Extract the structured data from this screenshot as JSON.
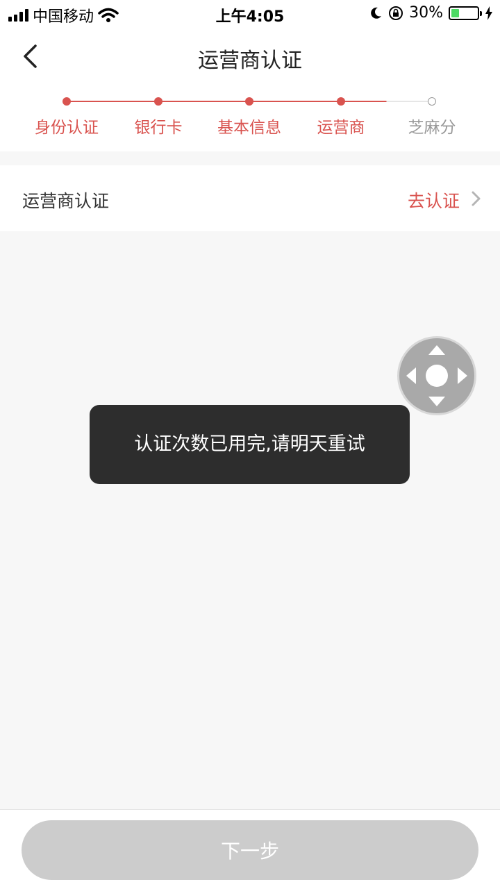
{
  "status_bar": {
    "carrier": "中国移动",
    "time": "上午4:05",
    "battery_percent": "30%",
    "battery_level": 0.3
  },
  "nav": {
    "title": "运营商认证",
    "back_icon": "chevron-left-icon"
  },
  "steps": {
    "items": [
      {
        "label": "身份认证",
        "state": "done"
      },
      {
        "label": "银行卡",
        "state": "done"
      },
      {
        "label": "基本信息",
        "state": "done"
      },
      {
        "label": "运营商",
        "state": "current"
      },
      {
        "label": "芝麻分",
        "state": "pending"
      }
    ],
    "active_color": "#d9534f",
    "pending_color": "#999999"
  },
  "carrier_row": {
    "label": "运营商认证",
    "action": "去认证"
  },
  "toast": {
    "message": "认证次数已用完,请明天重试"
  },
  "footer": {
    "next_label": "下一步"
  },
  "colors": {
    "accent": "#d9534f",
    "background": "#f7f7f7",
    "button_disabled": "#cccccc",
    "toast_bg": "#2d2d2d"
  }
}
